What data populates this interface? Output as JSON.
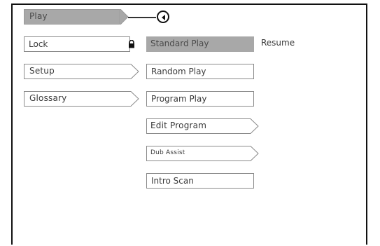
{
  "left_menu": {
    "play": "Play",
    "lock": "Lock",
    "setup": "Setup",
    "glossary": "Glossary"
  },
  "play_submenu": {
    "standard_play": "Standard Play",
    "resume": "Resume",
    "random_play": "Random Play",
    "program_play": "Program Play",
    "edit_program": "Edit Program",
    "dub_assist": "Dub Assist",
    "intro_scan": "Intro Scan"
  },
  "icons": {
    "back": "back-arrow-icon",
    "lock": "lock-icon"
  }
}
